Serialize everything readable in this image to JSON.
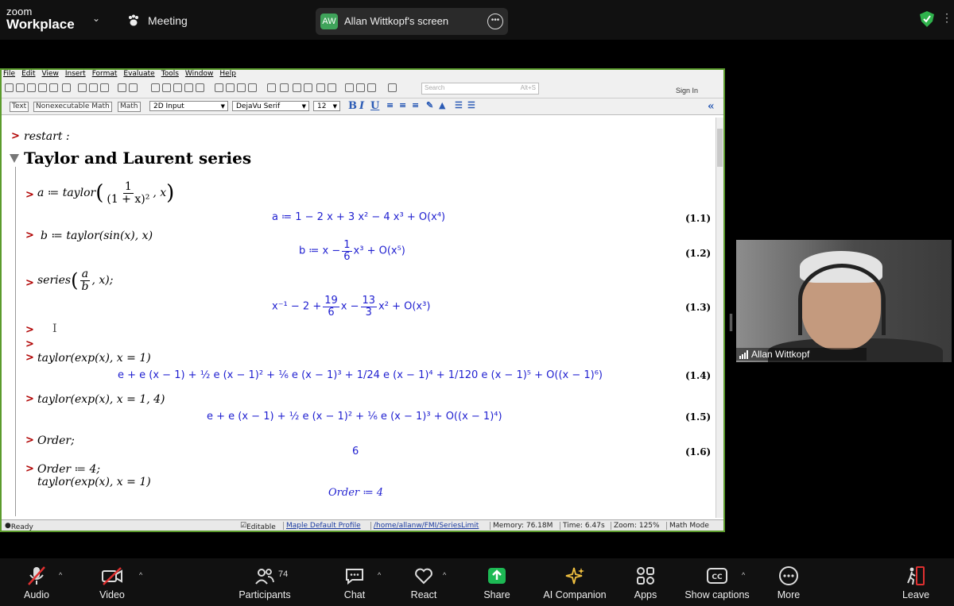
{
  "zoom": {
    "logo_line1": "zoom",
    "logo_line2": "Workplace",
    "meeting_label": "Meeting",
    "screen_share_initials": "AW",
    "screen_share_name": "Allan Wittkopf's screen"
  },
  "maple": {
    "menu": [
      "File",
      "Edit",
      "View",
      "Insert",
      "Format",
      "Evaluate",
      "Tools",
      "Window",
      "Help"
    ],
    "search_placeholder": "Search",
    "search_shortcut": "Alt+S",
    "sign_in": "Sign In",
    "mode_tags": [
      "Text",
      "Nonexecutable Math",
      "Math"
    ],
    "input_mode": "2D Input",
    "font": "DejaVu Serif",
    "font_size": "12",
    "section_title": "Taylor and Laurent series",
    "lines": {
      "restart": "restart :",
      "in1_pre": "a ≔ taylor",
      "in1_num": "1",
      "in1_den": "(1 + x)²",
      "in1_post": ", x",
      "out1": "a ≔ 1 − 2 x + 3 x² − 4 x³ + O(x⁴)",
      "lbl1": "(1.1)",
      "in2": "b ≔ taylor(sin(x), x)",
      "out2_pre": "b ≔ x −",
      "out2_num": "1",
      "out2_den": "6",
      "out2_post": "x³ + O(x⁵)",
      "lbl2": "(1.2)",
      "in3_pre": "series",
      "in3_num": "a",
      "in3_den": "b",
      "in3_post": ", x);",
      "out3_pre": "x⁻¹ − 2 +",
      "out3_n1": "19",
      "out3_d1": "6",
      "out3_mid": "x −",
      "out3_n2": "13",
      "out3_d2": "3",
      "out3_post": "x² + O(x³)",
      "lbl3": "(1.3)",
      "in4": "taylor(exp(x), x = 1)",
      "out4": "e + e (x − 1) + ½ e (x − 1)² + ⅙ e (x − 1)³ + 1/24 e (x − 1)⁴ + 1/120 e (x − 1)⁵ + O((x − 1)⁶)",
      "lbl4": "(1.4)",
      "in5": "taylor(exp(x), x = 1, 4)",
      "out5": "e + e (x − 1) + ½ e (x − 1)² + ⅙ e (x − 1)³ + O((x − 1)⁴)",
      "lbl5": "(1.5)",
      "in6": "Order;",
      "out6": "6",
      "lbl6": "(1.6)",
      "in7a": "Order ≔ 4;",
      "in7b": "taylor(exp(x), x = 1)",
      "out7": "Order ≔ 4"
    },
    "status": {
      "ready": "Ready",
      "editable": "Editable",
      "profile": "Maple Default Profile",
      "path": "/home/allanw/FMI/SeriesLimit",
      "memory": "Memory: 76.18M",
      "time": "Time: 6.47s",
      "zoom": "Zoom: 125%",
      "mode": "Math Mode"
    }
  },
  "participant": {
    "name": "Allan Wittkopf"
  },
  "controls": {
    "audio": "Audio",
    "video": "Video",
    "participants": "Participants",
    "participants_count": "74",
    "chat": "Chat",
    "react": "React",
    "share": "Share",
    "ai": "AI Companion",
    "apps": "Apps",
    "captions": "Show captions",
    "more": "More",
    "leave": "Leave"
  }
}
